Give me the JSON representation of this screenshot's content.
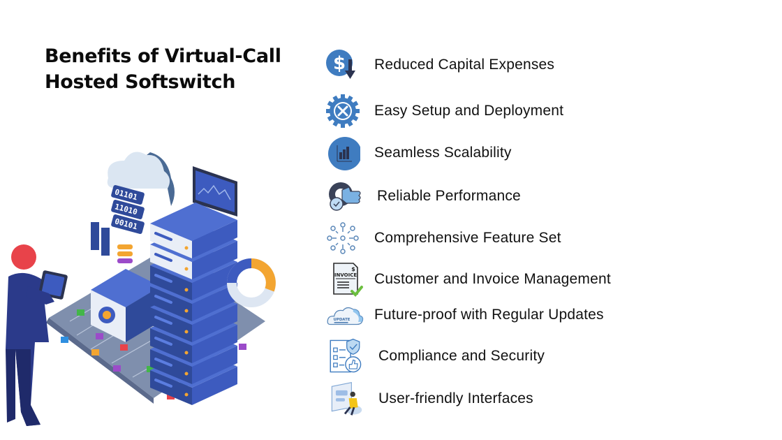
{
  "title": {
    "line1": "Benefits of Virtual-Call",
    "line2": "Hosted Softswitch"
  },
  "benefits": [
    {
      "label": "Reduced Capital Expenses",
      "icon": "dollar-down-arrow-icon"
    },
    {
      "label": "Easy Setup and Deployment",
      "icon": "gear-tools-icon"
    },
    {
      "label": "Seamless Scalability",
      "icon": "scalability-chart-icon"
    },
    {
      "label": "Reliable Performance",
      "icon": "gear-thumbs-up-icon"
    },
    {
      "label": "Comprehensive Feature Set",
      "icon": "network-nodes-icon"
    },
    {
      "label": "Customer and Invoice Management",
      "icon": "invoice-check-icon"
    },
    {
      "label": "Future-proof with Regular Updates",
      "icon": "cloud-update-icon"
    },
    {
      "label": "Compliance and Security",
      "icon": "checklist-shield-icon"
    },
    {
      "label": "User-friendly Interfaces",
      "icon": "user-interface-icon"
    }
  ],
  "illustration": {
    "binary_rows": [
      "01101",
      "11010",
      "00101"
    ],
    "invoice_text": "INVOICE",
    "update_text": "UPDATE"
  },
  "colors": {
    "icon_blue": "#3f7cc0",
    "dark_navy": "#2b3350",
    "server_blue": "#3d5bbf",
    "accent_orange": "#f3a531",
    "accent_red": "#e8434a"
  }
}
